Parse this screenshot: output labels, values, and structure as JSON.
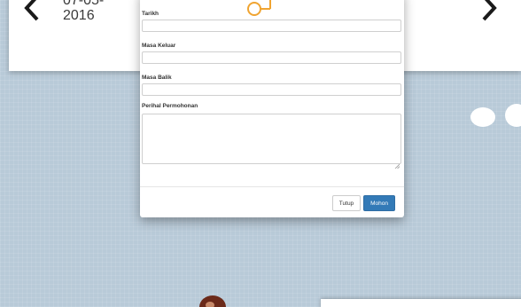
{
  "background_card": {
    "date_line1": "07-05-",
    "date_line2": "2016",
    "prev_icon": "chevron-left-icon",
    "next_icon": "chevron-right-icon"
  },
  "modal": {
    "icon": "key-icon",
    "accent_color": "#f0a431",
    "fields": {
      "tarikh_label": "Tarikh",
      "keluar_label": "Masa Keluar",
      "balik_label": "Masa Balik",
      "perihal_label": "Perihal Permohonan"
    },
    "buttons": {
      "close_label": "Tutup",
      "submit_label": "Mohon"
    },
    "primary_color": "#337ab7"
  }
}
